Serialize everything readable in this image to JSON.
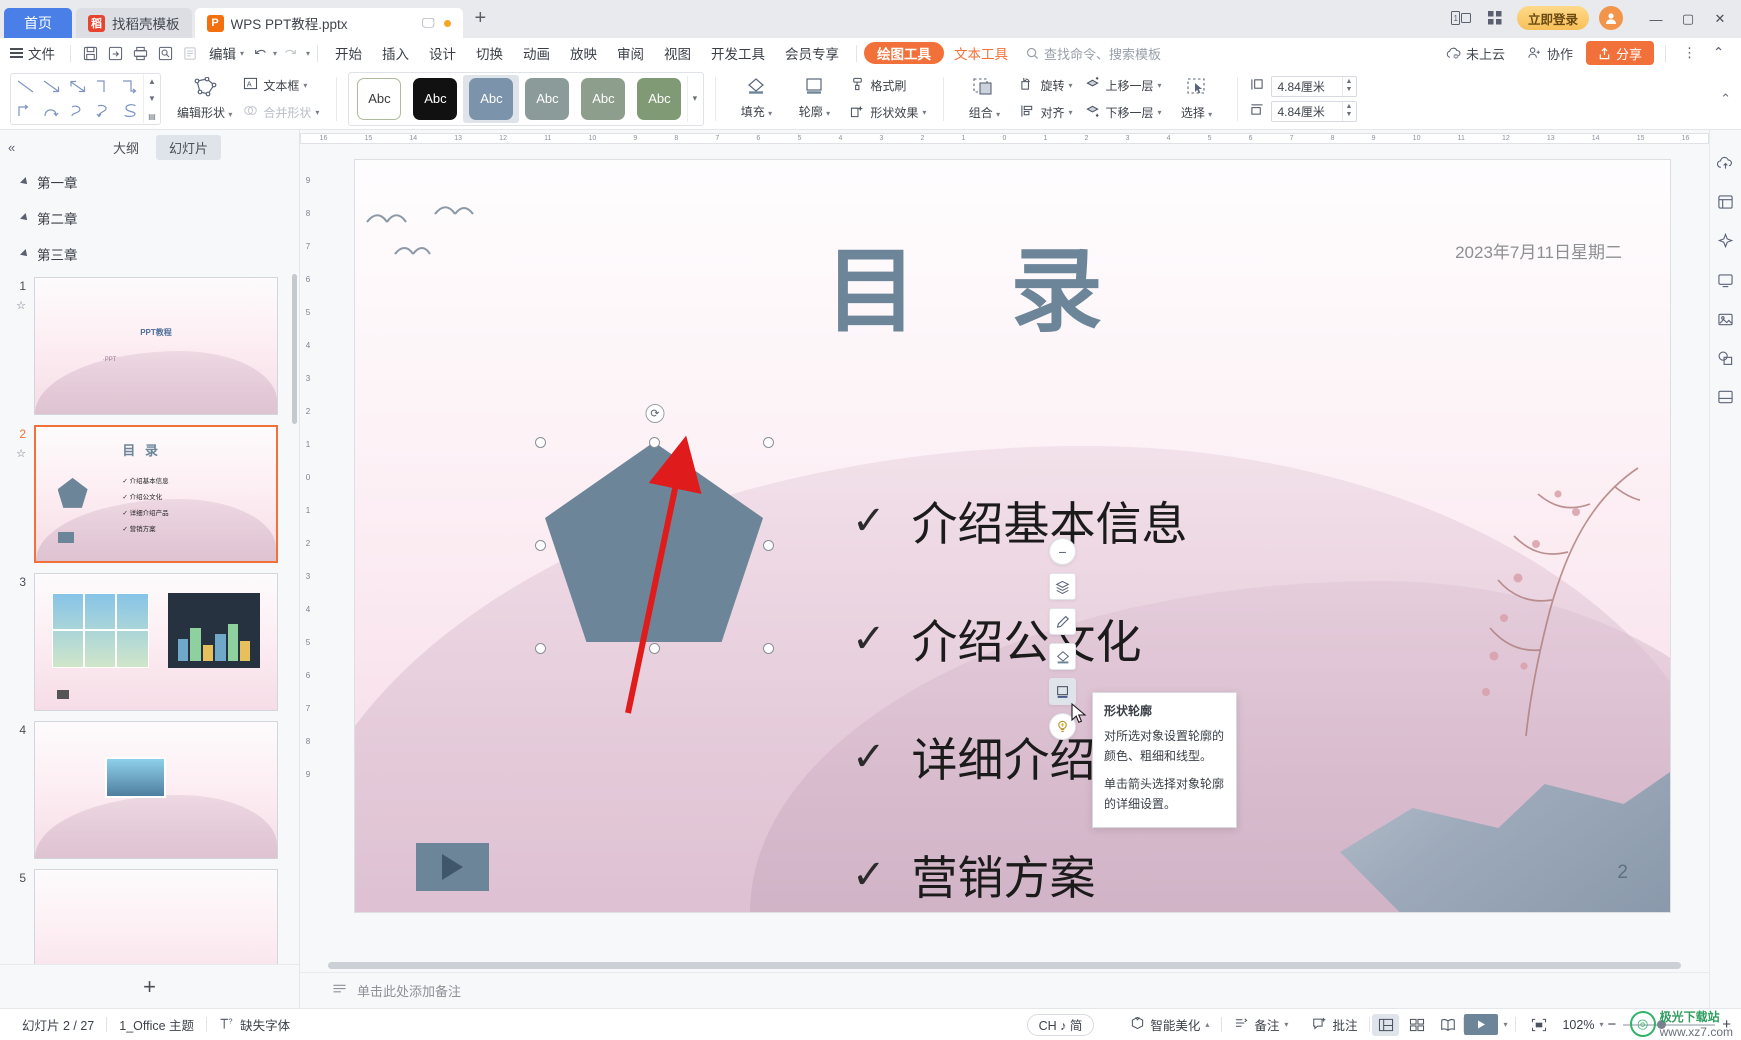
{
  "tabbar": {
    "home_label": "首页",
    "tabs": [
      {
        "label": "找稻壳模板",
        "icon": "docer-icon",
        "icon_letter": "稻"
      },
      {
        "label": "WPS PPT教程.pptx",
        "icon": "ppt-file-icon",
        "icon_letter": "P"
      }
    ],
    "new_tab": "+",
    "vip_label": "立即登录",
    "window": {
      "minimize": "—",
      "maximize": "▢",
      "close": "✕"
    }
  },
  "menubar": {
    "file_label": "文件",
    "quick_icons": [
      "save-icon",
      "save-as-cloud-icon",
      "print-icon",
      "print-preview-icon",
      "edit-note-icon"
    ],
    "edit_label": "编辑",
    "undo_icon": "undo-icon",
    "redo_icon": "redo-icon",
    "more_icon": "chevron-down-icon",
    "items": [
      "开始",
      "插入",
      "设计",
      "切换",
      "动画",
      "放映",
      "审阅",
      "视图",
      "开发工具",
      "会员专享"
    ],
    "tool_draw": "绘图工具",
    "tool_text": "文本工具",
    "search_placeholder": "查找命令、搜索模板",
    "cloud_label": "未上云",
    "collab_label": "协作",
    "share_label": "分享",
    "overflow_icon": "more-vertical-icon",
    "collapse_icon": "chevron-up-icon"
  },
  "ribbon": {
    "shape_gallery_glyphs": [
      "＼",
      "↘",
      "↖",
      "⌐",
      "⌐",
      "↳",
      "↺",
      "↻",
      "⤸",
      "Ｓ"
    ],
    "edit_shape": "编辑形状",
    "textbox": "文本框",
    "merge_shapes": "合并形状",
    "style_swatches": [
      {
        "name": "style-white",
        "bg": "#ffffff",
        "fg": "#3a3a3a",
        "border": "#aebb9c",
        "label": "Abc"
      },
      {
        "name": "style-black",
        "bg": "#111111",
        "fg": "#ffffff",
        "border": "#111111",
        "label": "Abc"
      },
      {
        "name": "style-blue-gray",
        "bg": "#7b93ab",
        "fg": "#ffffff",
        "border": "#7b93ab",
        "label": "Abc",
        "selected": true
      },
      {
        "name": "style-slate",
        "bg": "#8a9b99",
        "fg": "#ffffff",
        "border": "#8a9b99",
        "label": "Abc"
      },
      {
        "name": "style-sage",
        "bg": "#8d9e8c",
        "fg": "#ffffff",
        "border": "#8d9e8c",
        "label": "Abc"
      },
      {
        "name": "style-green",
        "bg": "#7f9a74",
        "fg": "#ffffff",
        "border": "#7f9a74",
        "label": "Abc"
      }
    ],
    "fill": "填充",
    "outline": "轮廓",
    "format_painter": "格式刷",
    "shape_effects": "形状效果",
    "group": "组合",
    "align": "对齐",
    "rotate": "旋转",
    "bring_forward": "上移一层",
    "send_backward": "下移一层",
    "select": "选择",
    "height_value": "4.84厘米",
    "width_value": "4.84厘米"
  },
  "leftpanel": {
    "collapse_icon": "collapse-left-icon",
    "tab_outline": "大纲",
    "tab_slides": "幻灯片",
    "chapters": [
      "第一章",
      "第二章",
      "第三章"
    ],
    "slides": [
      {
        "num": "1",
        "title_text": "PPT教程",
        "sub_text": "·PPT",
        "selected": false
      },
      {
        "num": "2",
        "title_text": "目 录",
        "selected": true,
        "bullets": [
          "✓ 介绍基本信息",
          "✓ 介绍公文化",
          "✓ 详细介绍产品",
          "✓ 营销方案"
        ]
      },
      {
        "num": "3",
        "selected": false
      },
      {
        "num": "4",
        "selected": false
      },
      {
        "num": "5",
        "selected": false
      }
    ],
    "add_slide": "+"
  },
  "slide": {
    "date": "2023年7月11日星期二",
    "title": "目 录",
    "page_number": "2",
    "items": [
      {
        "check": "✓",
        "text": "介绍基本信息"
      },
      {
        "check": "✓",
        "text": "介绍公文化"
      },
      {
        "check": "✓",
        "text": "详细介绍产品"
      },
      {
        "check": "✓",
        "text": "营销方案"
      }
    ],
    "shape": {
      "name": "pentagon",
      "fill": "#6d8599"
    }
  },
  "minitoolbar": {
    "buttons": [
      {
        "name": "collapse-minus-icon",
        "glyph": "−",
        "round": true
      },
      {
        "name": "layers-icon",
        "glyph": "◈"
      },
      {
        "name": "pen-icon",
        "glyph": "✎"
      },
      {
        "name": "shape-fill-icon",
        "glyph": "◇"
      },
      {
        "name": "shape-outline-icon",
        "glyph": "▣",
        "hovered": true
      },
      {
        "name": "shape-effects-icon",
        "glyph": "◉"
      }
    ]
  },
  "tooltip": {
    "title": "形状轮廓",
    "body1": "对所选对象设置轮廓的颜色、粗细和线型。",
    "body2": "单击箭头选择对象轮廓的详细设置。"
  },
  "rightrail": {
    "icons": [
      "share-cloud-icon",
      "design-idea-icon",
      "sparkle-icon",
      "screen-icon",
      "image-icon",
      "shapes-icon",
      "layout-icon"
    ]
  },
  "notes": {
    "placeholder": "单击此处添加备注",
    "icon": "notes-icon"
  },
  "status": {
    "slide_index": "幻灯片 2 / 27",
    "theme": "1_Office 主题",
    "missing_font": "缺失字体",
    "ime": "CH ♪ 简",
    "beautify": "智能美化",
    "notes_btn": "备注",
    "comment_btn": "批注",
    "views": [
      "normal-view-icon",
      "slide-sorter-icon",
      "reading-view-icon"
    ],
    "play_icon": "play-icon",
    "fit_icon": "fit-to-window-icon",
    "zoom": "102%",
    "zoom_out": "−",
    "zoom_in": "+"
  },
  "watermark": {
    "brand": "极光下载站",
    "url": "www.xz7.com"
  },
  "ruler": {
    "h_ticks": [
      "16",
      "15",
      "14",
      "13",
      "12",
      "11",
      "10",
      "9",
      "8",
      "7",
      "6",
      "5",
      "4",
      "3",
      "2",
      "1",
      "0",
      "1",
      "2",
      "3",
      "4",
      "5",
      "6",
      "7",
      "8",
      "9",
      "10",
      "11",
      "12",
      "13",
      "14",
      "15",
      "16"
    ],
    "v_ticks": [
      "9",
      "8",
      "7",
      "6",
      "5",
      "4",
      "3",
      "2",
      "1",
      "0",
      "1",
      "2",
      "3",
      "4",
      "5",
      "6",
      "7",
      "8",
      "9"
    ]
  },
  "colors": {
    "accent": "#f2703a",
    "home_tab": "#4a7fe8",
    "shape": "#6d8599",
    "title": "#6d8599"
  }
}
